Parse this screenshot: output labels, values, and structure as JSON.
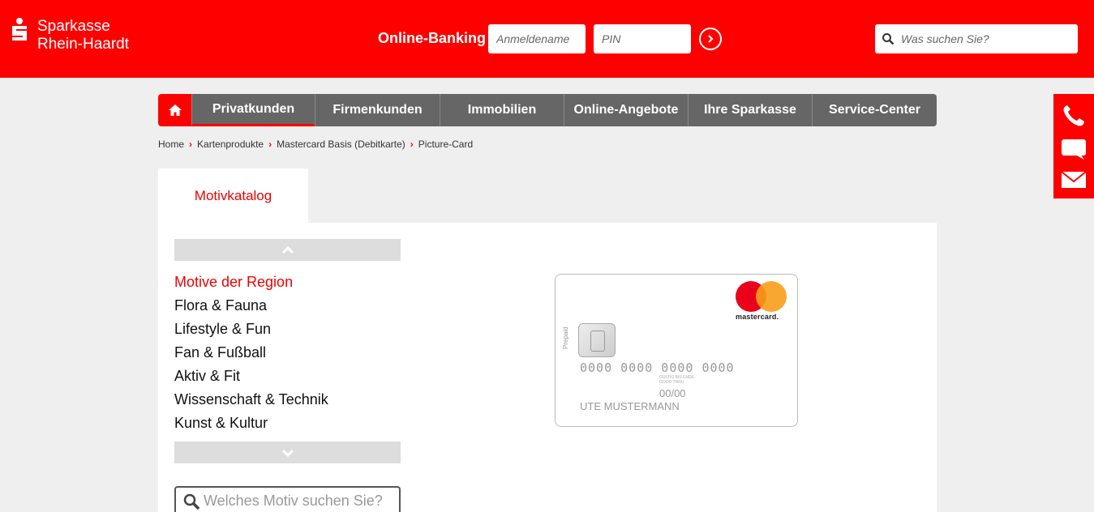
{
  "header": {
    "logo_line1": "Sparkasse",
    "logo_line2": "Rhein-Haardt",
    "online_banking_label": "Online-Banking",
    "username_placeholder": "Anmeldename",
    "pin_placeholder": "PIN",
    "search_placeholder": "Was suchen Sie?",
    "brand_color": "#ff0000"
  },
  "nav": {
    "items": [
      {
        "label": "Privatkunden",
        "active": true
      },
      {
        "label": "Firmenkunden"
      },
      {
        "label": "Immobilien"
      },
      {
        "label": "Online-Angebote"
      },
      {
        "label": "Ihre Sparkasse"
      },
      {
        "label": "Service-Center"
      }
    ]
  },
  "breadcrumb": [
    "Home",
    "Kartenprodukte",
    "Mastercard Basis (Debitkarte)",
    "Picture-Card"
  ],
  "content": {
    "tab_label": "Motivkatalog",
    "categories": [
      "Motive der Region",
      "Flora & Fauna",
      "Lifestyle & Fun",
      "Fan & Fußball",
      "Aktiv & Fit",
      "Wissenschaft & Technik",
      "Kunst & Kultur"
    ],
    "motiv_search_placeholder": "Welches Motiv suchen Sie?"
  },
  "card": {
    "brand": "mastercard.",
    "prepaid": "Prepaid",
    "number": "0000 0000 0000 0000",
    "good_thru": "GÜLTIG BIS ENDE GOOD THRU",
    "expiry": "00/00",
    "holder": "UTE MUSTERMANN"
  }
}
